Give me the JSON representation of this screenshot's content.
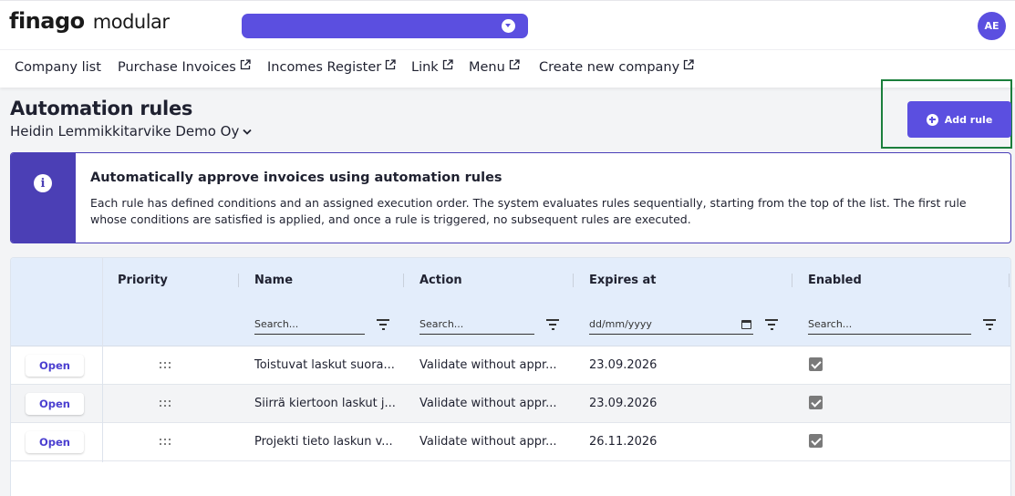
{
  "header": {
    "logo_brand": "finago",
    "logo_product": "modular",
    "avatar_initials": "AE",
    "accent_color": "#5b4fe0"
  },
  "nav": {
    "items": [
      {
        "label": "Company list",
        "external": false
      },
      {
        "label": "Purchase Invoices",
        "external": true
      },
      {
        "label": "Incomes Register",
        "external": true
      },
      {
        "label": "Link",
        "external": true
      },
      {
        "label": "Menu",
        "external": true
      },
      {
        "label": "Create new company",
        "external": true
      }
    ]
  },
  "page": {
    "title": "Automation rules",
    "company": "Heidin Lemmikkitarvike Demo Oy",
    "add_button_label": "Add rule"
  },
  "info": {
    "icon": "info-icon",
    "title": "Automatically approve invoices using automation rules",
    "text": "Each rule has defined conditions and an assigned execution order. The system evaluates rules sequentially, starting from the top of the list. The first rule whose conditions are satisfied is applied, and once a rule is triggered, no subsequent rules are executed."
  },
  "grid": {
    "columns": [
      "Priority",
      "Name",
      "Action",
      "Expires at",
      "Enabled"
    ],
    "filters": {
      "name_placeholder": "Search...",
      "action_placeholder": "Search...",
      "expires_placeholder": "dd/mm/yyyy",
      "enabled_placeholder": "Search..."
    },
    "open_label": "Open",
    "rows": [
      {
        "name": "Toistuvat laskut suora...",
        "action": "Validate without appr...",
        "expires": "23.09.2026",
        "enabled": true
      },
      {
        "name": "Siirrä kiertoon laskut j...",
        "action": "Validate without appr...",
        "expires": "23.09.2026",
        "enabled": true
      },
      {
        "name": "Projekti tieto laskun v...",
        "action": "Validate without appr...",
        "expires": "26.11.2026",
        "enabled": true
      }
    ]
  }
}
